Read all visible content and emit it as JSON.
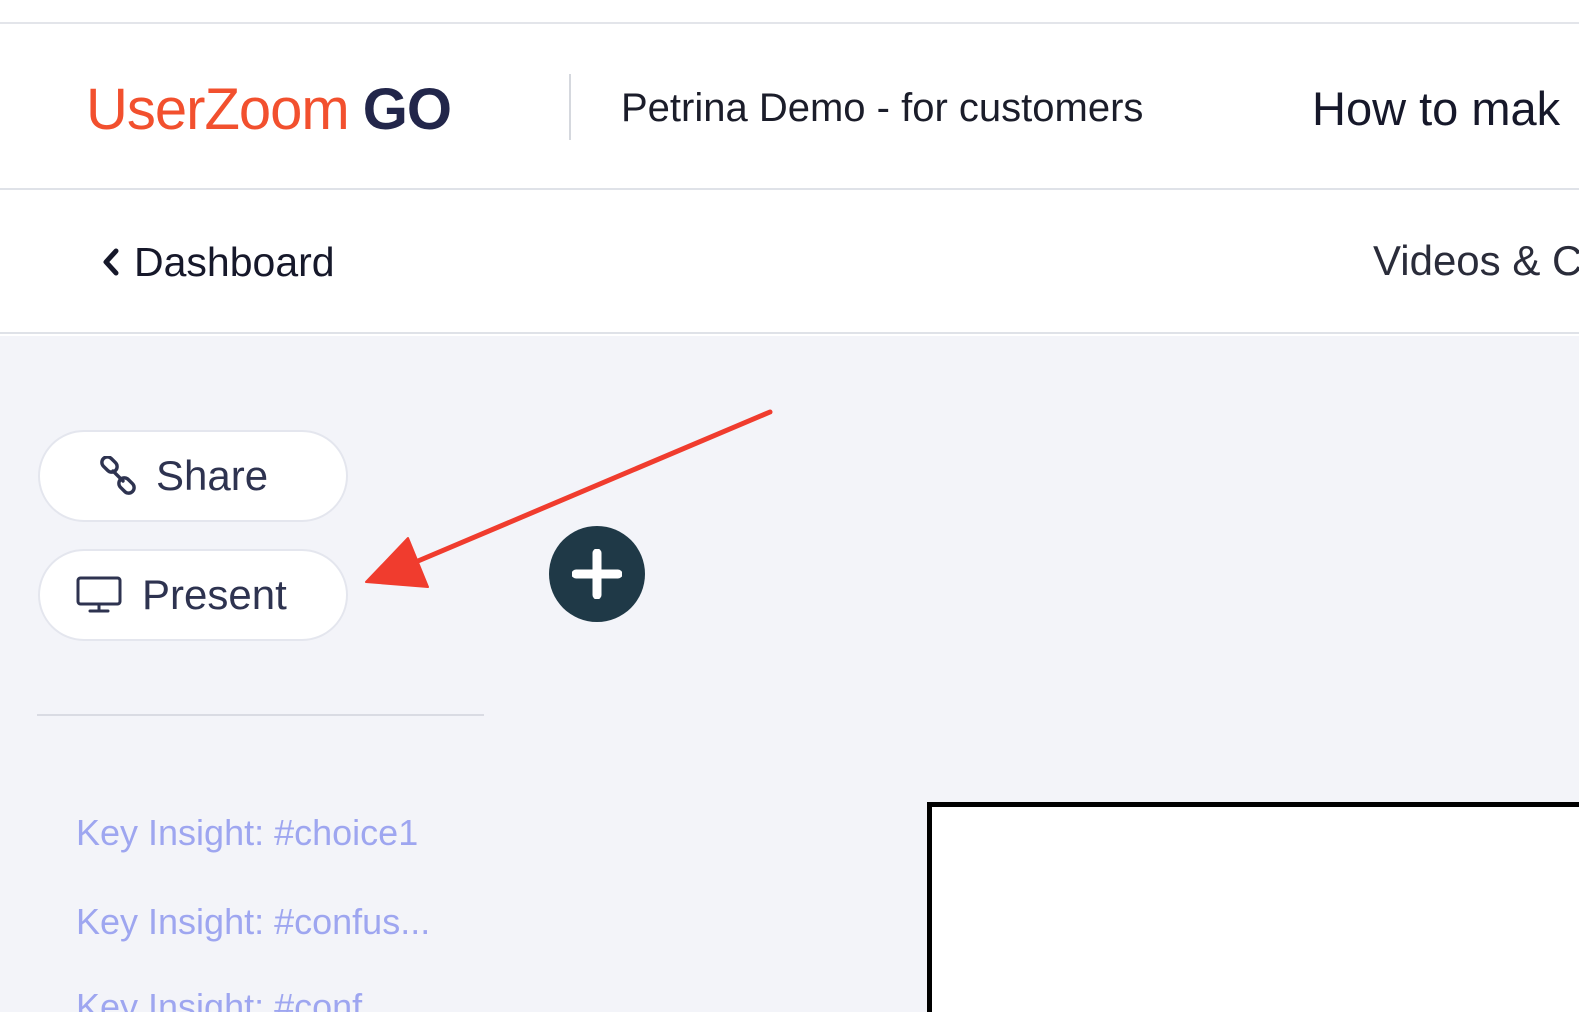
{
  "header": {
    "brand": "UserZoom",
    "brand_suffix": "GO",
    "project_name": "Petrina Demo - for customers",
    "study_title": "How to mak"
  },
  "subnav": {
    "back_label": "Dashboard",
    "tab_label": "Videos & C"
  },
  "sidebar": {
    "share_label": "Share",
    "present_label": "Present",
    "insights": [
      "Key Insight: #choice1",
      "Key Insight: #confus...",
      "Key Insight: #conf..."
    ]
  },
  "icons": {
    "back": "chevron-left-icon",
    "share": "link-icon",
    "present": "monitor-icon",
    "add": "plus-icon",
    "annotation": "arrow-icon"
  },
  "colors": {
    "brand_orange": "#f2502e",
    "brand_navy": "#22264a",
    "add_button": "#1f3947",
    "insight_link": "#9ea6f0",
    "annotation_arrow": "#f03c2e",
    "content_bg": "#f3f4f9"
  }
}
